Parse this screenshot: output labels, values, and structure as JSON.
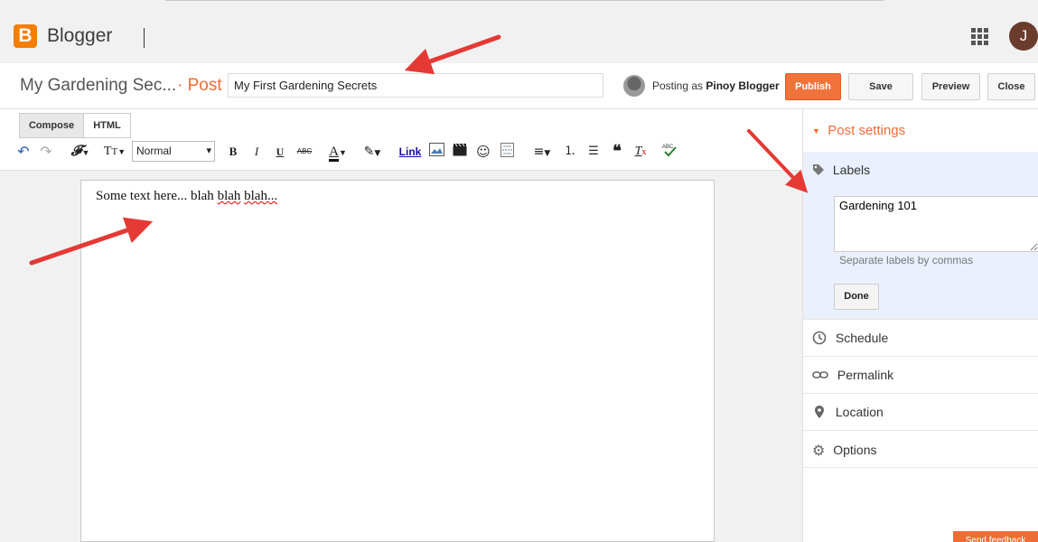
{
  "header": {
    "logo_letter": "B",
    "brand": "Blogger",
    "account_initial": "J"
  },
  "postbar": {
    "blog_name": "My Gardening Sec...",
    "post_label": "· Post",
    "title_value": "My First Gardening Secrets",
    "posting_as_prefix": "Posting as ",
    "posting_as_user": "Pinoy Blogger",
    "publish": "Publish",
    "save": "Save",
    "preview": "Preview",
    "close": "Close"
  },
  "toolbar": {
    "compose": "Compose",
    "html": "HTML",
    "font_size": "Normal",
    "link": "Link"
  },
  "editor": {
    "body_plain": "Some text here... ",
    "body_blah1": "blah",
    "body_space": " ",
    "body_blah2": "blah",
    "body_space2": " ",
    "body_blah3": "blah..."
  },
  "sidebar": {
    "post_settings": "Post settings",
    "labels": "Labels",
    "labels_value": "Gardening 101",
    "labels_hint": "Separate labels by commas",
    "done": "Done",
    "schedule": "Schedule",
    "permalink": "Permalink",
    "location": "Location",
    "options": "Options"
  },
  "feedback": "Send feedback",
  "colors": {
    "accent": "#ef6c36",
    "publish": "#f0733c",
    "labels_bg": "#eaf1fd",
    "arrow": "#e53935"
  }
}
